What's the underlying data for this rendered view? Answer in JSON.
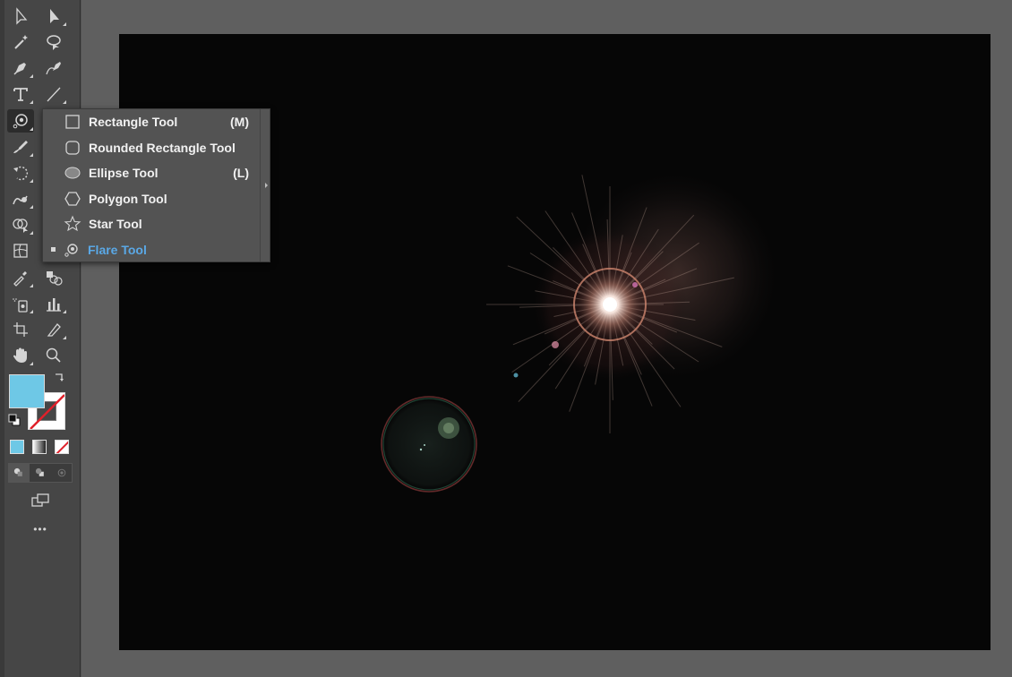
{
  "colors": {
    "fill": "#6ec8e6",
    "stroke": "none",
    "highlight": "#5aa8e6",
    "artboard": "#060606"
  },
  "toolbar": {
    "tools": [
      "selection-tool",
      "direct-selection-tool",
      "magic-wand-tool",
      "lasso-tool",
      "pen-tool",
      "curvature-tool",
      "type-tool",
      "line-segment-tool",
      "flare-tool",
      "paintbrush-tool",
      "shaper-tool",
      "eraser-tool",
      "rotate-tool",
      "scale-tool",
      "warp-tool",
      "free-transform-tool",
      "shape-builder-tool",
      "perspective-grid-tool",
      "mesh-tool",
      "gradient-tool",
      "eyedropper-tool",
      "blend-tool",
      "symbol-sprayer-tool",
      "column-graph-tool",
      "artboard-tool",
      "slice-tool",
      "hand-tool",
      "zoom-tool"
    ],
    "more_label": "•••"
  },
  "flyout": {
    "items": [
      {
        "label": "Rectangle Tool",
        "shortcut": "(M)",
        "icon": "rectangle-icon",
        "selected": false
      },
      {
        "label": "Rounded Rectangle Tool",
        "shortcut": "",
        "icon": "rounded-rectangle-icon",
        "selected": false
      },
      {
        "label": "Ellipse Tool",
        "shortcut": "(L)",
        "icon": "ellipse-icon",
        "selected": false
      },
      {
        "label": "Polygon Tool",
        "shortcut": "",
        "icon": "polygon-icon",
        "selected": false
      },
      {
        "label": "Star Tool",
        "shortcut": "",
        "icon": "star-icon",
        "selected": false
      },
      {
        "label": "Flare Tool",
        "shortcut": "",
        "icon": "flare-icon",
        "selected": true
      }
    ]
  }
}
